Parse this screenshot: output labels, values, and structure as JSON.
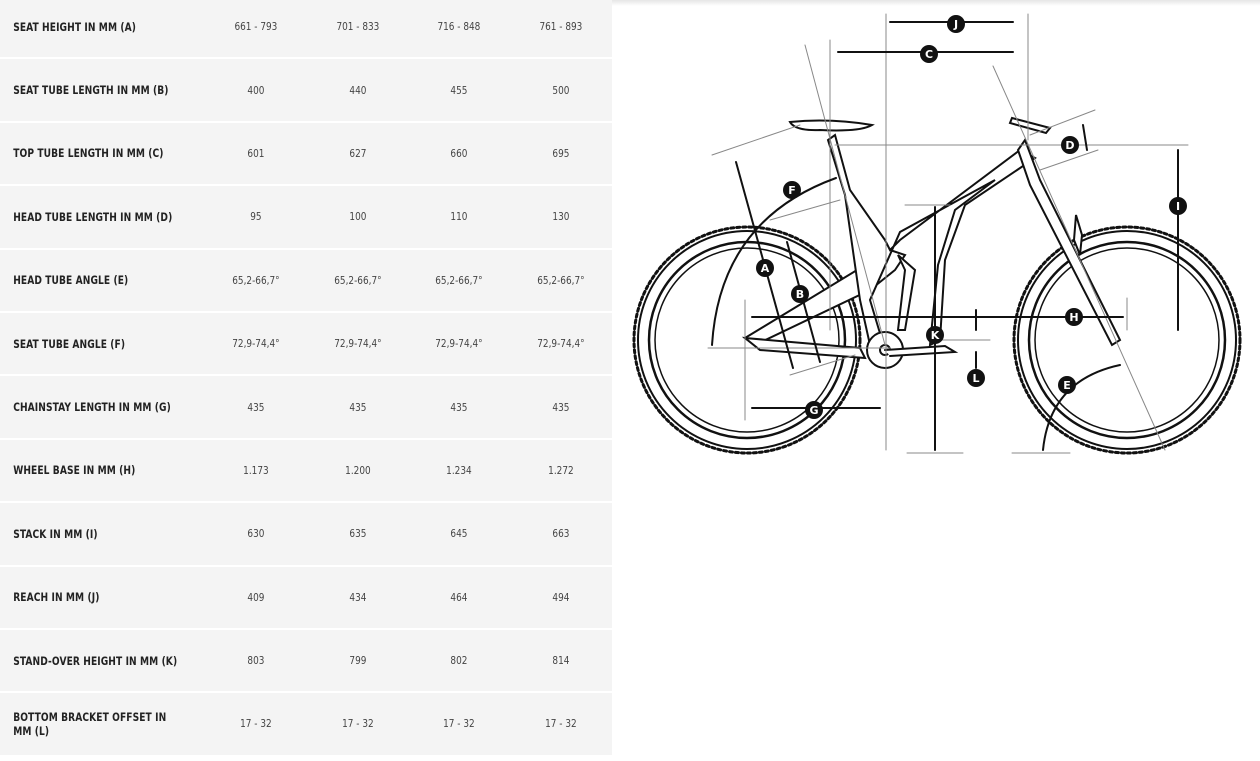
{
  "geometry_table": {
    "rows": [
      {
        "label": "SEAT HEIGHT IN MM (A)",
        "values": [
          "661 - 793",
          "701 - 833",
          "716 - 848",
          "761 - 893"
        ]
      },
      {
        "label": "SEAT TUBE LENGTH IN MM (B)",
        "values": [
          "400",
          "440",
          "455",
          "500"
        ]
      },
      {
        "label": "TOP TUBE LENGTH IN MM (C)",
        "values": [
          "601",
          "627",
          "660",
          "695"
        ]
      },
      {
        "label": "HEAD TUBE LENGTH IN MM (D)",
        "values": [
          "95",
          "100",
          "110",
          "130"
        ]
      },
      {
        "label": "HEAD TUBE ANGLE (E)",
        "values": [
          "65,2-66,7°",
          "65,2-66,7°",
          "65,2-66,7°",
          "65,2-66,7°"
        ]
      },
      {
        "label": "SEAT TUBE ANGLE (F)",
        "values": [
          "72,9-74,4°",
          "72,9-74,4°",
          "72,9-74,4°",
          "72,9-74,4°"
        ]
      },
      {
        "label": "CHAINSTAY LENGTH IN MM (G)",
        "values": [
          "435",
          "435",
          "435",
          "435"
        ]
      },
      {
        "label": "WHEEL BASE IN MM (H)",
        "values": [
          "1.173",
          "1.200",
          "1.234",
          "1.272"
        ]
      },
      {
        "label": "STACK IN MM (I)",
        "values": [
          "630",
          "635",
          "645",
          "663"
        ]
      },
      {
        "label": "REACH IN MM (J)",
        "values": [
          "409",
          "434",
          "464",
          "494"
        ]
      },
      {
        "label": "STAND-OVER HEIGHT IN MM (K)",
        "values": [
          "803",
          "799",
          "802",
          "814"
        ]
      },
      {
        "label": "BOTTOM BRACKET OFFSET IN MM (L)",
        "values": [
          "17 - 32",
          "17 - 32",
          "17 - 32",
          "17 - 32"
        ]
      }
    ]
  },
  "diagram": {
    "labels": {
      "A": "A",
      "B": "B",
      "C": "C",
      "D": "D",
      "E": "E",
      "F": "F",
      "G": "G",
      "H": "H",
      "I": "I",
      "J": "J",
      "K": "K",
      "L": "L"
    }
  }
}
